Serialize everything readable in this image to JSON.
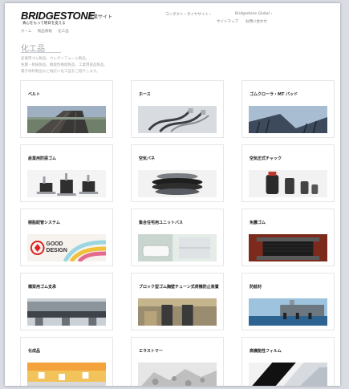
{
  "header": {
    "logo": "BRIDGESTONE",
    "tagline": "真心をもって明日を変える",
    "site_label": "産業サイト",
    "links": [
      "コンタクト・タイヤサイト ›",
      "Bridgestone Global ›",
      "サイトマップ",
      "お問い合わせ"
    ]
  },
  "breadcrumb": [
    "ホーム",
    "製品情報",
    "化工品"
  ],
  "page": {
    "title": "化工品",
    "intro": "産業用ゴム製品、ウレタンフォーム製品、\n免震・制振製品、機能性樹脂製品、工業用部品製品、\n電子材料製品など幅広い化工品をご紹介します。"
  },
  "products": [
    {
      "label": "ベルト",
      "icon": "conveyor-belt"
    },
    {
      "label": "ホース",
      "icon": "hose"
    },
    {
      "label": "ゴムクローラ・MT パッド",
      "icon": "rubber-crawler"
    },
    {
      "label": "産業用防振ゴム",
      "icon": "anti-vibration-mounts"
    },
    {
      "label": "空気バネ",
      "icon": "air-spring"
    },
    {
      "label": "空気圧式チャック",
      "icon": "pneumatic-chuck"
    },
    {
      "label": "樹脂配管システム",
      "icon": "resin-piping",
      "image_text": [
        "GOOD",
        "DESIGN"
      ]
    },
    {
      "label": "集合住宅用ユニットバス",
      "icon": "unit-bath"
    },
    {
      "label": "免震ゴム",
      "icon": "seismic-isolator"
    },
    {
      "label": "橋梁用ゴム支承",
      "icon": "bridge-bearing"
    },
    {
      "label": "ブロック型ゴム胸壁チューン式荷機防止装置",
      "icon": "block-rubber-fender"
    },
    {
      "label": "防舷材",
      "icon": "marine-fender"
    },
    {
      "label": "化成品",
      "icon": "chemical-products"
    },
    {
      "label": "エラストマー",
      "icon": "elastomer"
    },
    {
      "label": "高機能性フィルム",
      "icon": "functional-film"
    }
  ]
}
